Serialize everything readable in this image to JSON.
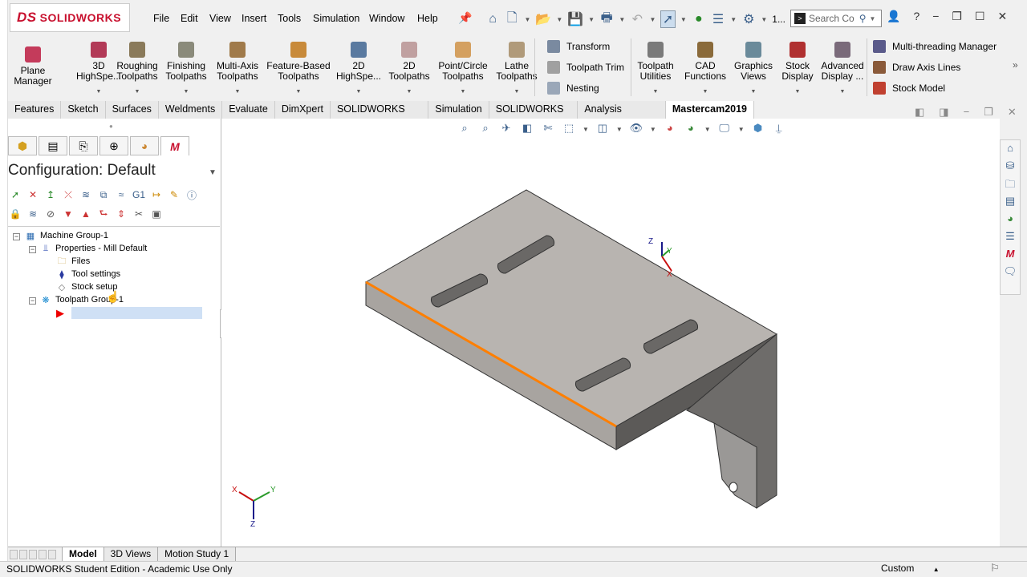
{
  "app": {
    "logo_ds": "DS",
    "logo_name": "SOLIDWORKS",
    "status_text": "SOLIDWORKS Student Edition - Academic Use Only",
    "units": "Custom",
    "quick_badge": "1..."
  },
  "menu": [
    "File",
    "Edit",
    "View",
    "Insert",
    "Tools",
    "Simulation",
    "Window",
    "Help"
  ],
  "search": {
    "placeholder": "Search Co"
  },
  "ribbon": {
    "plane_manager": "Plane\nManager",
    "buttons": [
      "3D\nHighSpe...",
      "Roughing\nToolpaths",
      "Finishing\nToolpaths",
      "Multi-Axis\nToolpaths",
      "Feature-Based\nToolpaths",
      "2D\nHighSpe...",
      "2D\nToolpaths",
      "Point/Circle\nToolpaths",
      "Lathe\nToolpaths"
    ],
    "small_left": [
      "Transform",
      "Toolpath Trim",
      "Nesting"
    ],
    "buttons_right": [
      "Toolpath\nUtilities",
      "CAD\nFunctions",
      "Graphics\nViews",
      "Stock\nDisplay",
      "Advanced\nDisplay ..."
    ],
    "small_right": [
      "Multi-threading Manager",
      "Draw Axis Lines",
      "Stock Model"
    ]
  },
  "tabs": [
    "Features",
    "Sketch",
    "Surfaces",
    "Weldments",
    "Evaluate",
    "DimXpert",
    "SOLIDWORKS Add-Ins",
    "Simulation",
    "SOLIDWORKS MBD",
    "Analysis Preparation",
    "Mastercam2019"
  ],
  "active_tab": "Mastercam2019",
  "panel": {
    "config_label": "Configuration:  Default",
    "toolbar_g1": "G1"
  },
  "tree": {
    "machine_group": "Machine Group-1",
    "properties": "Properties - Mill Default",
    "files": "Files",
    "tool_settings": "Tool settings",
    "stock_setup": "Stock setup",
    "toolpath_group": "Toolpath Group-1"
  },
  "triad": {
    "x": "X",
    "y": "Y",
    "z": "Z"
  },
  "bottom_tabs": [
    "Model",
    "3D Views",
    "Motion Study 1"
  ],
  "colors": {
    "accent": "#c8102e",
    "selection_edge": "#ff7f00",
    "part_top": "#b8b4b0",
    "part_side": "#8e8a86",
    "part_dark": "#5c5a58"
  }
}
